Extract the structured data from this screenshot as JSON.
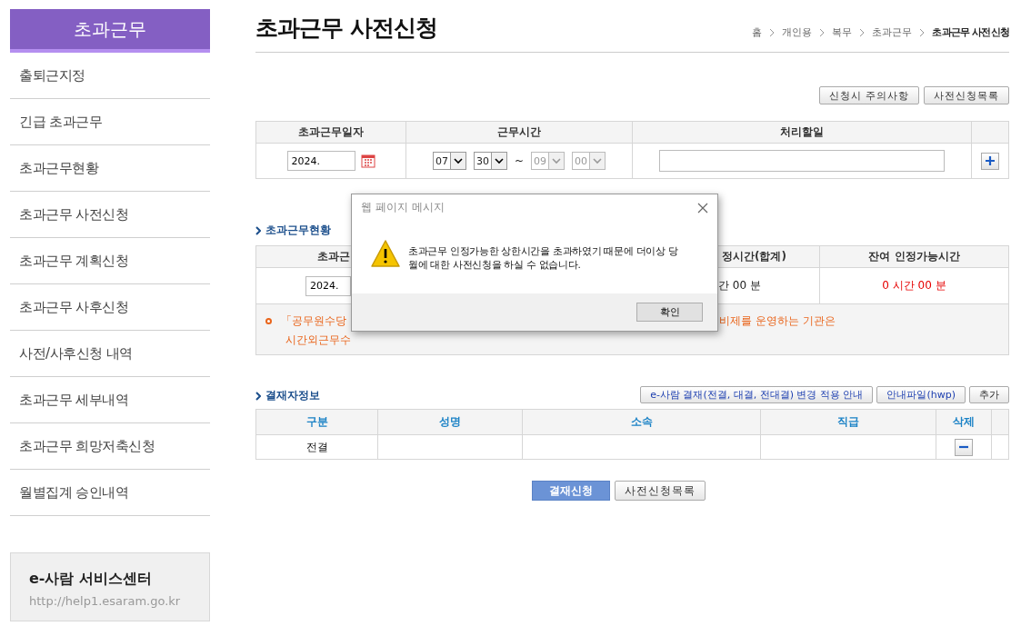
{
  "sidebar": {
    "title": "초과근무",
    "items": [
      {
        "label": "출퇴근지정"
      },
      {
        "label": "긴급 초과근무"
      },
      {
        "label": "초과근무현황"
      },
      {
        "label": "초과근무 사전신청"
      },
      {
        "label": "초과근무 계획신청"
      },
      {
        "label": "초과근무 사후신청"
      },
      {
        "label": "사전/사후신청 내역"
      },
      {
        "label": "초과근무 세부내역"
      },
      {
        "label": "초과근무 희망저축신청"
      },
      {
        "label": "월별집계 승인내역"
      }
    ],
    "service_center": {
      "title": "e-사람 서비스센터",
      "url": "http://help1.esaram.go.kr"
    }
  },
  "page": {
    "title": "초과근무 사전신청",
    "breadcrumb": [
      "홈",
      "개인용",
      "복무",
      "초과근무",
      "초과근무 사전신청"
    ]
  },
  "top_buttons": [
    "신청시 주의사항",
    "사전신청목록"
  ],
  "request_table": {
    "columns": [
      "초과근무일자",
      "근무시간",
      "처리할일"
    ],
    "date": "2024.",
    "times": [
      {
        "value": "07",
        "disabled": false
      },
      {
        "value": "30",
        "disabled": false
      },
      {
        "value": "09",
        "disabled": true
      },
      {
        "value": "00",
        "disabled": true
      }
    ],
    "separator": "~"
  },
  "status": {
    "heading": "초과근무현황",
    "columns": [
      "초과근",
      "정시간(합계)",
      "잔여 인정가능시간"
    ],
    "date": "2024.",
    "total": "간 00 분",
    "remaining": "0 시간 00 분",
    "notice": {
      "line1_left": "「공무원수당",
      "line1_right": "비제를 운영하는 기관은",
      "line2": "시간외근무수"
    }
  },
  "approvers": {
    "heading": "결재자정보",
    "buttons": [
      "e-사람 결재(전결, 대결, 전대결) 변경 적용 안내",
      "안내파일(hwp)",
      "추가"
    ],
    "columns": [
      "구분",
      "성명",
      "소속",
      "직급",
      "삭제"
    ],
    "rows": [
      {
        "type": "전결"
      }
    ]
  },
  "bottom_buttons": [
    {
      "label": "결재신청",
      "kind": "primary"
    },
    {
      "label": "사전신청목록",
      "kind": "default"
    }
  ],
  "dialog": {
    "title": "웹 페이지 메시지",
    "message_lines": [
      "초과근무 인정가능한 상한시간을 초과하였기 때문에 더이상 당",
      "월에 대한 사전신청을 하실 수 없습니다."
    ],
    "ok": "확인"
  }
}
